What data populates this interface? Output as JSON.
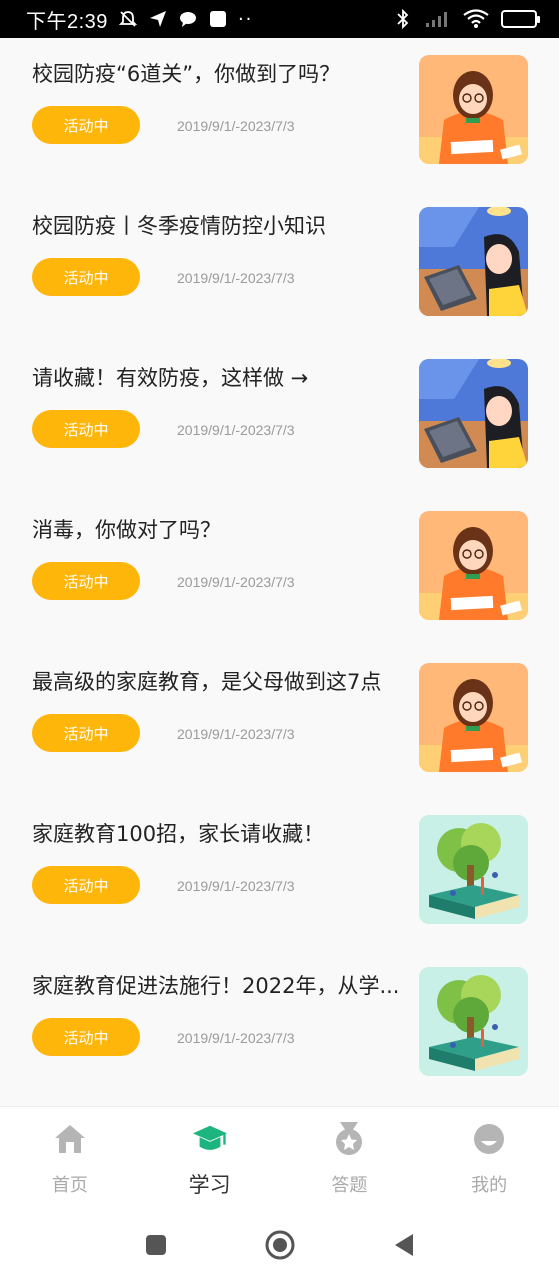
{
  "status_bar": {
    "time": "下午2:39",
    "battery": "69",
    "dots": "··"
  },
  "list": {
    "badge_label": "活动中",
    "items": [
      {
        "title": "校园防疫“6道关”，你做到了吗？",
        "date": "2019/9/1/-2023/7/3",
        "image": "girl-studying"
      },
      {
        "title": "校园防疫丨冬季疫情防控小知识",
        "date": "2019/9/1/-2023/7/3",
        "image": "girl-laptop"
      },
      {
        "title": "请收藏！有效防疫，这样做 →",
        "date": "2019/9/1/-2023/7/3",
        "image": "girl-laptop"
      },
      {
        "title": "消毒，你做对了吗？",
        "date": "2019/9/1/-2023/7/3",
        "image": "girl-studying"
      },
      {
        "title": "最高级的家庭教育，是父母做到这7点",
        "date": "2019/9/1/-2023/7/3",
        "image": "girl-studying"
      },
      {
        "title": "家庭教育100招，家长请收藏！",
        "date": "2019/9/1/-2023/7/3",
        "image": "tree-book"
      },
      {
        "title": "家庭教育促进法施行！2022年，从学...",
        "date": "2019/9/1/-2023/7/3",
        "image": "tree-book"
      }
    ]
  },
  "tabbar": {
    "tabs": [
      {
        "label": "首页",
        "icon": "home-icon",
        "active": false
      },
      {
        "label": "学习",
        "icon": "graduation-cap-icon",
        "active": true
      },
      {
        "label": "答题",
        "icon": "medal-icon",
        "active": false
      },
      {
        "label": "我的",
        "icon": "profile-icon",
        "active": false
      }
    ],
    "active_color": "#1db57f",
    "inactive_color": "#b5b5b5"
  },
  "colors": {
    "badge": "#ffb60a",
    "date_text": "#9a9a9a",
    "background": "#f9f9f9"
  }
}
